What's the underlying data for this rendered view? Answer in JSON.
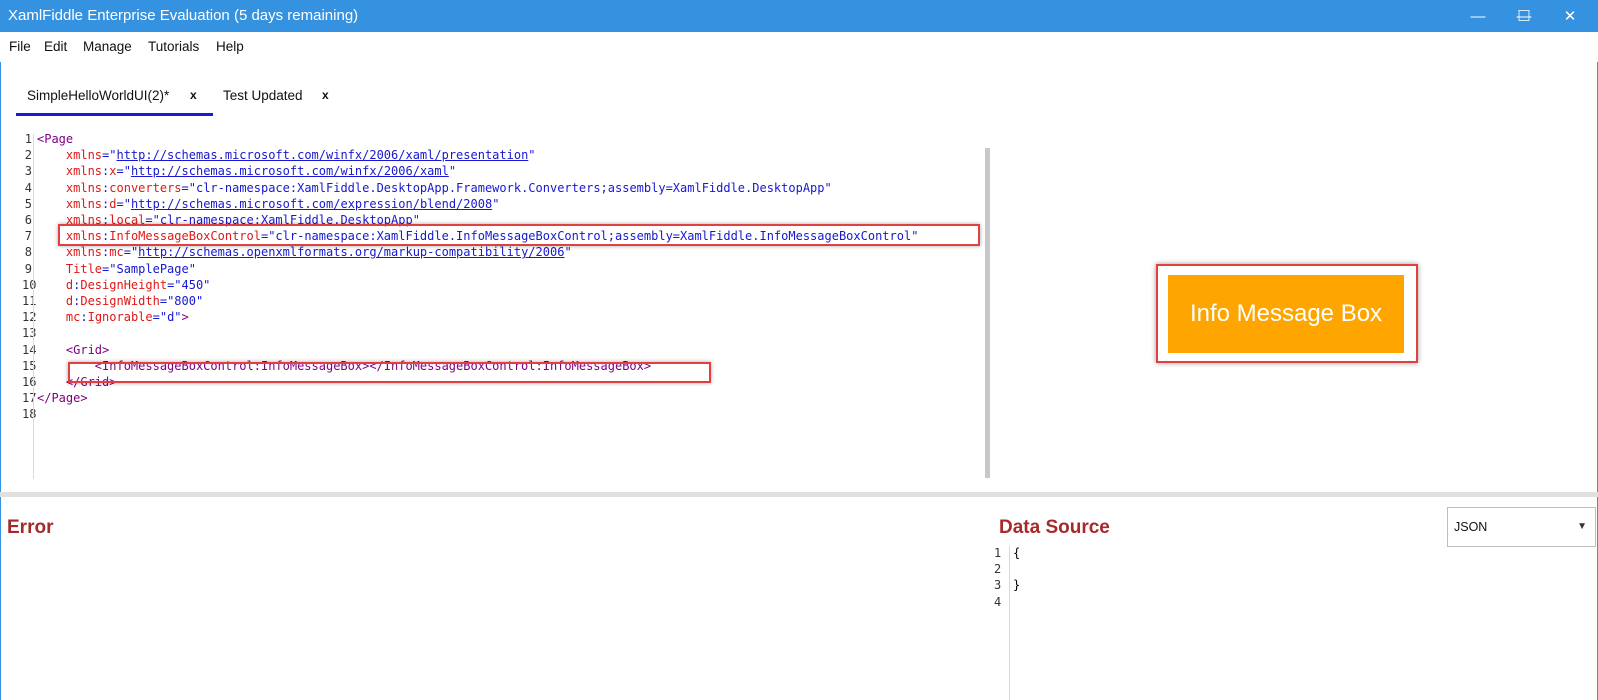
{
  "window": {
    "title": "XamlFiddle Enterprise Evaluation (5 days remaining)",
    "controls": {
      "minimize": "—",
      "maximize": "☐",
      "close": "✕"
    }
  },
  "menu": [
    "File",
    "Edit",
    "Manage",
    "Tutorials",
    "Help"
  ],
  "tabs": [
    {
      "label": "SimpleHelloWorldUI(2)*",
      "close": "x",
      "active": true
    },
    {
      "label": "Test Updated",
      "close": "x",
      "active": false
    }
  ],
  "editor": {
    "line_numbers": [
      "1",
      "2",
      "3",
      "4",
      "5",
      "6",
      "7",
      "8",
      "9",
      "10",
      "11",
      "12",
      "13",
      "14",
      "15",
      "16",
      "17",
      "18"
    ],
    "lines": [
      [
        {
          "t": "t",
          "s": "<Page"
        }
      ],
      [
        {
          "t": "a",
          "s": "    xmlns"
        },
        {
          "t": "p",
          "s": "=\""
        },
        {
          "t": "u",
          "s": "http://schemas.microsoft.com/winfx/2006/xaml/presentation"
        },
        {
          "t": "p",
          "s": "\""
        }
      ],
      [
        {
          "t": "a",
          "s": "    xmlns"
        },
        {
          "t": "p",
          "s": ":"
        },
        {
          "t": "a",
          "s": "x"
        },
        {
          "t": "p",
          "s": "=\""
        },
        {
          "t": "u",
          "s": "http://schemas.microsoft.com/winfx/2006/xaml"
        },
        {
          "t": "p",
          "s": "\""
        }
      ],
      [
        {
          "t": "a",
          "s": "    xmlns"
        },
        {
          "t": "p",
          "s": ":"
        },
        {
          "t": "a",
          "s": "converters"
        },
        {
          "t": "v",
          "s": "=\"clr-namespace:XamlFiddle.DesktopApp.Framework.Converters;assembly=XamlFiddle.DesktopApp\""
        }
      ],
      [
        {
          "t": "a",
          "s": "    xmlns"
        },
        {
          "t": "p",
          "s": ":"
        },
        {
          "t": "a",
          "s": "d"
        },
        {
          "t": "p",
          "s": "=\""
        },
        {
          "t": "u",
          "s": "http://schemas.microsoft.com/expression/blend/2008"
        },
        {
          "t": "p",
          "s": "\""
        }
      ],
      [
        {
          "t": "a",
          "s": "    xmlns"
        },
        {
          "t": "p",
          "s": ":"
        },
        {
          "t": "a",
          "s": "local"
        },
        {
          "t": "v",
          "s": "=\"clr-namespace:XamlFiddle.DesktopApp\""
        }
      ],
      [
        {
          "t": "a",
          "s": "    xmlns"
        },
        {
          "t": "p",
          "s": ":"
        },
        {
          "t": "a",
          "s": "InfoMessageBoxControl"
        },
        {
          "t": "v",
          "s": "=\"clr-namespace:XamlFiddle.InfoMessageBoxControl;assembly=XamlFiddle.InfoMessageBoxControl\""
        }
      ],
      [
        {
          "t": "a",
          "s": "    xmlns"
        },
        {
          "t": "p",
          "s": ":"
        },
        {
          "t": "a",
          "s": "mc"
        },
        {
          "t": "p",
          "s": "=\""
        },
        {
          "t": "u",
          "s": "http://schemas.openxmlformats.org/markup-compatibility/2006"
        },
        {
          "t": "p",
          "s": "\""
        }
      ],
      [
        {
          "t": "a",
          "s": "    Title"
        },
        {
          "t": "v",
          "s": "=\"SamplePage\""
        }
      ],
      [
        {
          "t": "a",
          "s": "    d"
        },
        {
          "t": "p",
          "s": ":"
        },
        {
          "t": "a",
          "s": "DesignHeight"
        },
        {
          "t": "v",
          "s": "=\"450\""
        }
      ],
      [
        {
          "t": "a",
          "s": "    d"
        },
        {
          "t": "p",
          "s": ":"
        },
        {
          "t": "a",
          "s": "DesignWidth"
        },
        {
          "t": "v",
          "s": "=\"800\""
        }
      ],
      [
        {
          "t": "a",
          "s": "    mc"
        },
        {
          "t": "p",
          "s": ":"
        },
        {
          "t": "a",
          "s": "Ignorable"
        },
        {
          "t": "v",
          "s": "=\"d\""
        },
        {
          "t": "t",
          "s": ">"
        }
      ],
      [
        {
          "t": "p",
          "s": ""
        }
      ],
      [
        {
          "t": "t",
          "s": "    <Grid>"
        }
      ],
      [
        {
          "t": "t",
          "s": "        <InfoMessageBoxControl:InfoMessageBox></InfoMessageBoxControl:InfoMessageBox>"
        }
      ],
      [
        {
          "t": "t",
          "s": "    </Grid>"
        }
      ],
      [
        {
          "t": "t",
          "s": "</Page>"
        }
      ],
      [
        {
          "t": "p",
          "s": ""
        }
      ]
    ]
  },
  "preview": {
    "button_label": "Info Message Box",
    "button_color": "#ffa500"
  },
  "error_pane": {
    "title": "Error"
  },
  "data_source": {
    "title": "Data Source",
    "format_selected": "JSON",
    "line_numbers": [
      "1",
      "2",
      "3",
      "4"
    ],
    "lines": [
      "{",
      "",
      "}",
      ""
    ]
  },
  "colors": {
    "titlebar": "#3592e0",
    "heading": "#a52a2a",
    "highlight": "#e04040"
  }
}
